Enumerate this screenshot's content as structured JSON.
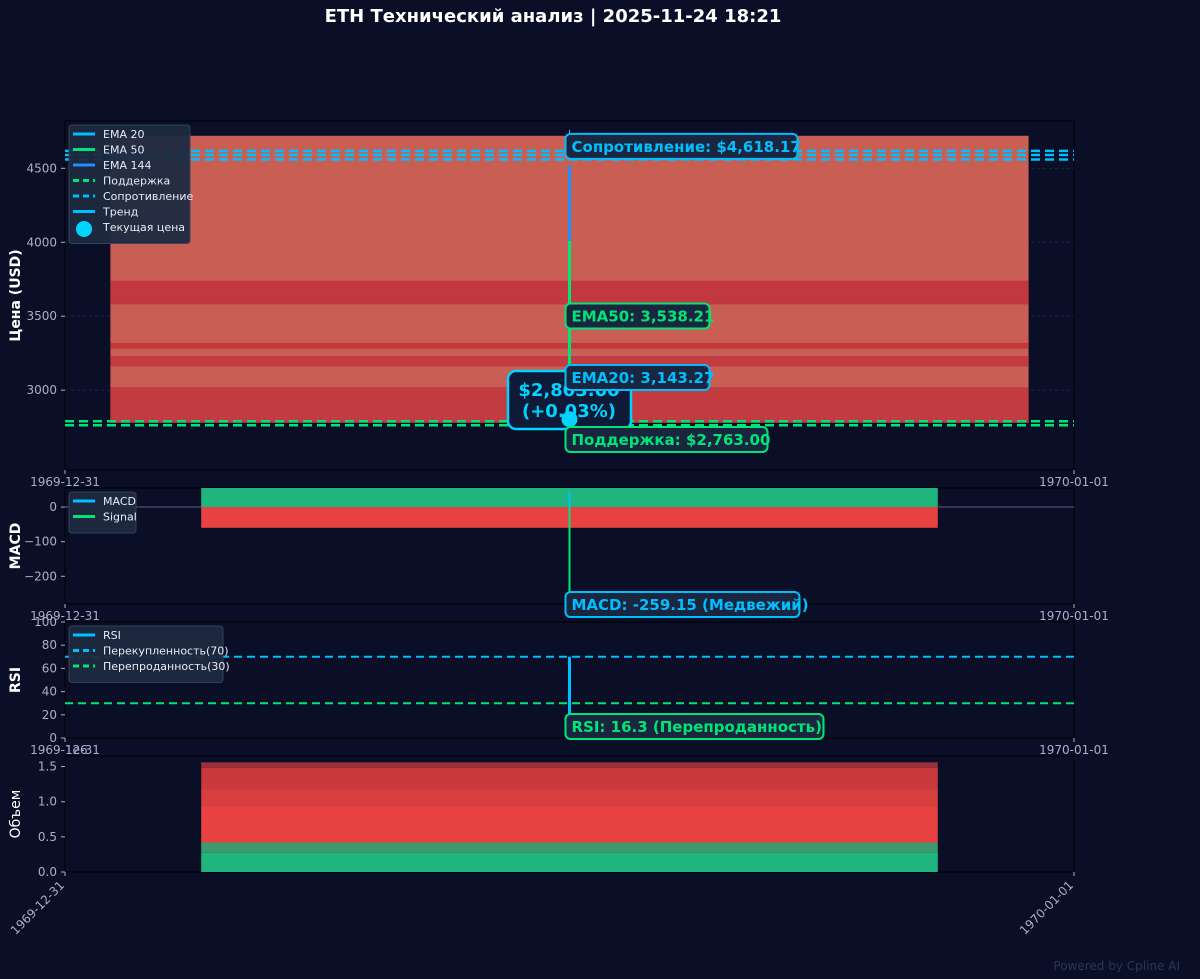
{
  "title": "ETH Технический анализ | 2025-11-24 18:21",
  "watermark": "Powered by Cpline AI",
  "colors": {
    "background": "#0a0e27",
    "panel": "#0a0e27",
    "ema20": "#00bfff",
    "ema50": "#00e676",
    "ema144": "#1e90ff",
    "support": "#00e676",
    "resistance": "#00bfff",
    "bear": "#e84142",
    "bull": "#1fb57e",
    "text": "#ffffff",
    "tick": "#a9b0c6",
    "current": "#00d4ff"
  },
  "chart_data": [
    {
      "id": "price",
      "type": "line",
      "ylabel": "Цена (USD)",
      "ylim": [
        2460,
        4820
      ],
      "yticks": [
        3000,
        3500,
        4000,
        4500
      ],
      "xticks": [
        "1969-12-31",
        "1970-01-01"
      ],
      "grid": true,
      "legend_position": "top-left",
      "legend": [
        "EMA 20",
        "EMA 50",
        "EMA 144",
        "Поддержка",
        "Сопротивление",
        "Тренд",
        "Текущая цена"
      ],
      "band": {
        "x": [
          0.045,
          0.955
        ],
        "low": 2780,
        "high": 4720
      },
      "band_stripes": [
        {
          "from": 2780,
          "to": 3020,
          "shade": 0.85
        },
        {
          "from": 3160,
          "to": 3230,
          "shade": 0.85
        },
        {
          "from": 3280,
          "to": 3320,
          "shade": 0.9
        },
        {
          "from": 3580,
          "to": 3620,
          "shade": 0.9
        },
        {
          "from": 3610,
          "to": 3740,
          "shade": 0.9
        }
      ],
      "ema_lines": [
        {
          "name": "EMA 20",
          "x": 0.5,
          "from": 2800,
          "to": 3143.27,
          "color": "#00bfff"
        },
        {
          "name": "EMA 50",
          "x": 0.5,
          "from": 3143.27,
          "to": 4010,
          "color": "#00e676"
        },
        {
          "name": "EMA 144",
          "x": 0.5,
          "from": 4010,
          "to": 4520,
          "color": "#1e90ff"
        }
      ],
      "support_lines": [
        2763,
        2790
      ],
      "resistance_lines": [
        4560,
        4590,
        4618.17
      ],
      "current_price": 2803.0,
      "annotations": {
        "resistance": "Сопротивление: $4,618.17",
        "ema50": "EMA50: 3,538.21",
        "ema20": "EMA20: 3,143.27",
        "price": "$2,803.00",
        "change": "(+0.03%)",
        "support": "Поддержка: $2,763.00"
      }
    },
    {
      "id": "macd",
      "type": "bar",
      "ylabel": "MACD",
      "ylim": [
        -280,
        55
      ],
      "yticks": [
        0,
        -100,
        -200
      ],
      "xticks": [
        "1969-12-31",
        "1970-01-01"
      ],
      "legend_position": "top-left",
      "legend": [
        "MACD",
        "Signal"
      ],
      "bar_extent": [
        0.135,
        0.865
      ],
      "pos_value": 55,
      "neg_value": -60,
      "line": {
        "x": 0.5,
        "from": -259.15,
        "to": 45
      },
      "annotation": "MACD: -259.15 (Медвежий)"
    },
    {
      "id": "rsi",
      "type": "line",
      "ylabel": "RSI",
      "ylim": [
        0,
        100
      ],
      "yticks": [
        0,
        20,
        40,
        60,
        80,
        100
      ],
      "xticks": [
        "1969-12-31",
        "1970-01-01"
      ],
      "legend_position": "top-left",
      "legend": [
        "RSI",
        "Перекупленность(70)",
        "Перепроданность(30)"
      ],
      "overbought": 70,
      "oversold": 30,
      "value": 16.3,
      "line": {
        "x": 0.5,
        "from": 16.3,
        "to": 70
      },
      "annotation": "RSI: 16.3 (Перепроданность)"
    },
    {
      "id": "volume",
      "type": "bar",
      "ylabel": "Объем",
      "ylim": [
        0,
        1.65
      ],
      "yticks": [
        0.0,
        0.5,
        1.0,
        1.5
      ],
      "offset_label": "1e6",
      "xticks": [
        "1969-12-31",
        "1970-01-01"
      ],
      "bar_extent": [
        0.135,
        0.865
      ],
      "stack": [
        {
          "from": 0,
          "to": 0.28,
          "color": "#1fb57e"
        },
        {
          "from": 0.28,
          "to": 0.42,
          "color": "#3c9a6c"
        },
        {
          "from": 0.42,
          "to": 0.95,
          "color": "#e84142"
        },
        {
          "from": 0.95,
          "to": 1.18,
          "color": "#d93e3f"
        },
        {
          "from": 1.18,
          "to": 1.48,
          "color": "#c83a3e"
        },
        {
          "from": 1.48,
          "to": 1.56,
          "color": "#9a3038"
        }
      ]
    }
  ]
}
